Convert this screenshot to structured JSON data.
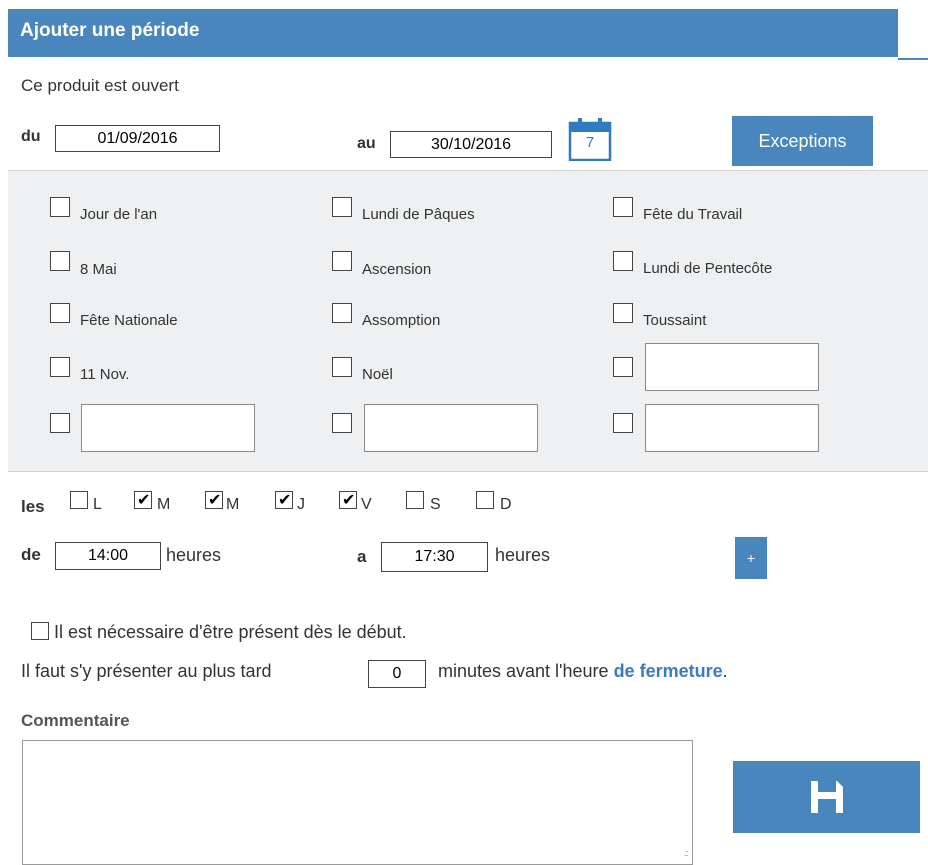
{
  "header": {
    "title": "Ajouter une période"
  },
  "period": {
    "intro": "Ce produit est ouvert",
    "from_label": "du",
    "from_value": "01/09/2016",
    "to_label": "au",
    "to_value": "30/10/2016",
    "calendar_day": "7",
    "exceptions_label": "Exceptions"
  },
  "holidays": {
    "items": [
      "Jour de l'an",
      "Lundi de Pâques",
      "Fête du Travail",
      "8 Mai",
      "Ascension",
      "Lundi de Pentecôte",
      "Fête Nationale",
      "Assomption",
      "Toussaint",
      "11 Nov.",
      "Noël"
    ],
    "custom_fields": 4
  },
  "days": {
    "label": "les",
    "items": [
      {
        "letter": "L",
        "checked": false
      },
      {
        "letter": "M",
        "checked": true
      },
      {
        "letter": "M",
        "checked": true
      },
      {
        "letter": "J",
        "checked": true
      },
      {
        "letter": "V",
        "checked": true
      },
      {
        "letter": "S",
        "checked": false
      },
      {
        "letter": "D",
        "checked": false
      }
    ]
  },
  "hours": {
    "from_label": "de",
    "from_value": "14:00",
    "unit": "heures",
    "to_label": "a",
    "to_value": "17:30",
    "add_label": "+"
  },
  "presence": {
    "must_be_present": "Il est nécessaire d'être présent dès le début.",
    "latest_prefix": "Il faut s'y présenter au plus tard",
    "latest_minutes": "0",
    "latest_middle": "minutes avant l'heure",
    "latest_link": "de fermeture",
    "latest_suffix": "."
  },
  "comment": {
    "label": "Commentaire",
    "value": ""
  },
  "colors": {
    "accent": "#4a86be",
    "panel": "#eef0f1",
    "link": "#3b7bbf"
  },
  "icons": {
    "calendar": "calendar-icon",
    "save": "floppy-disk-icon"
  }
}
